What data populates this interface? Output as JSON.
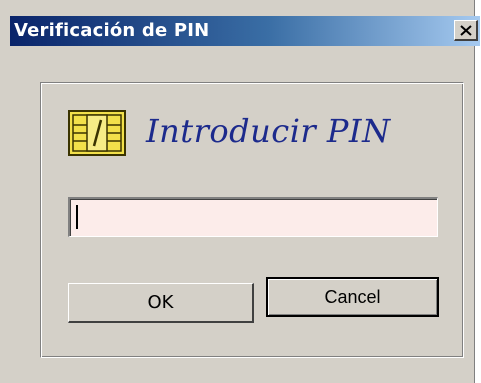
{
  "window": {
    "title": "Verificación de PIN",
    "close_label": "X"
  },
  "dialog": {
    "heading": "Introducir PIN",
    "icon": "smartcard-chip-icon",
    "pin": {
      "value": "",
      "placeholder": ""
    },
    "buttons": {
      "ok_label": "OK",
      "cancel_label": "Cancel"
    }
  },
  "colors": {
    "titlebar_start": "#0a246a",
    "titlebar_end": "#a6caf0",
    "dialog_bg": "#d4d0c8",
    "heading_color": "#1c2a8c",
    "input_bg": "#fcecea",
    "chip_gold": "#f2e04a"
  }
}
